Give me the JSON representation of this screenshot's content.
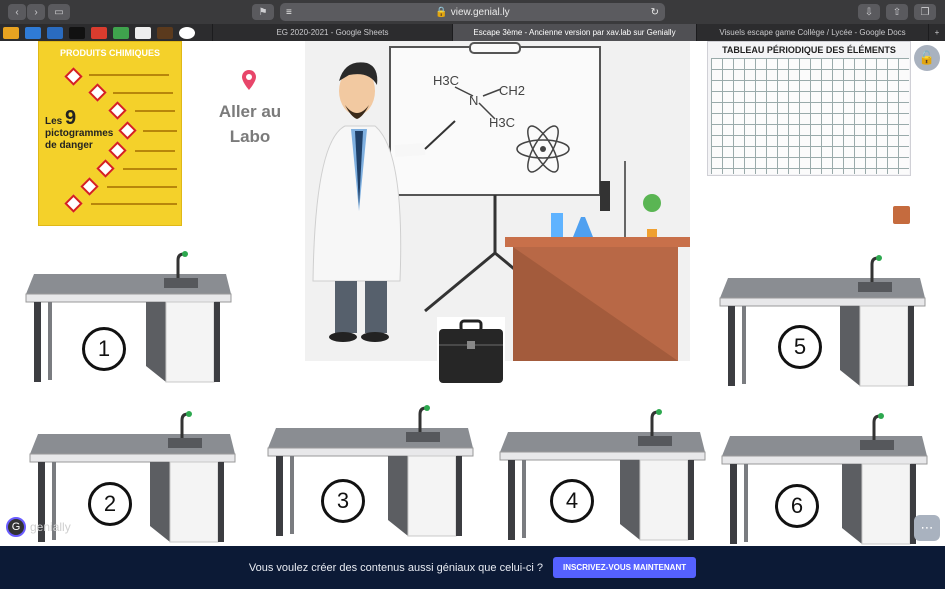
{
  "browser": {
    "url": "view.genial.ly",
    "tabs": [
      {
        "label": "EG 2020-2021 - Google Sheets",
        "active": false
      },
      {
        "label": "Escape 3ème - Ancienne version par xav.lab sur Genially",
        "active": true
      },
      {
        "label": "Visuels escape game Collège / Lycée - Google Docs",
        "active": false
      }
    ],
    "new_tab_label": "+"
  },
  "poster": {
    "title": "PRODUITS CHIMIQUES",
    "subtitle_prefix": "Les",
    "subtitle_number": "9",
    "subtitle_rest": "pictogrammes de danger"
  },
  "lab_link": {
    "label_line1": "Aller au",
    "label_line2": "Labo"
  },
  "whiteboard": {
    "h3c_left": "H3C",
    "n": "N",
    "ch2": "CH2",
    "h3c_bottom": "H3C"
  },
  "periodic_table": {
    "title": "TABLEAU PÉRIODIQUE DES ÉLÉMENTS"
  },
  "benches": [
    {
      "number": "1"
    },
    {
      "number": "2"
    },
    {
      "number": "3"
    },
    {
      "number": "4"
    },
    {
      "number": "5"
    },
    {
      "number": "6"
    }
  ],
  "genially": {
    "logo_text": "genially"
  },
  "banner": {
    "text": "Vous voulez créer des contenus aussi géniaux que celui-ci ?",
    "button": "INSCRIVEZ-VOUS MAINTENANT"
  },
  "colors": {
    "poster_yellow": "#f4d12a",
    "banner_bg": "#0c1a36",
    "banner_button": "#5561ff",
    "marker_pink": "#e8466a"
  }
}
